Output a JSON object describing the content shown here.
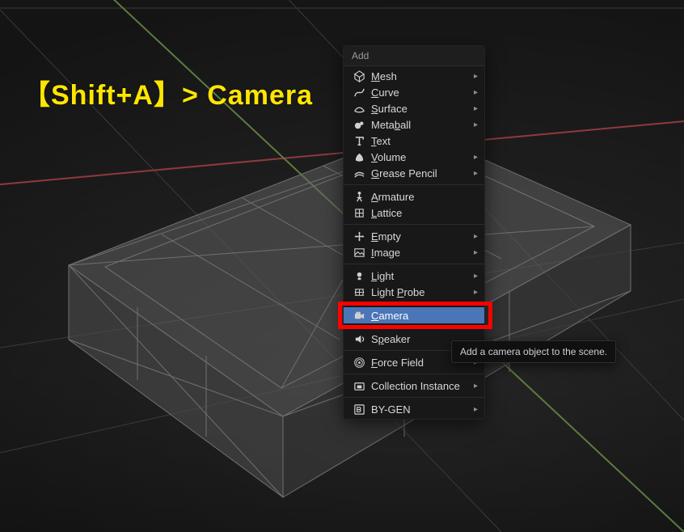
{
  "annotation": "【Shift+A】> Camera",
  "menu": {
    "title": "Add",
    "groups": [
      [
        {
          "icon": "mesh",
          "label": "Mesh",
          "underline": 0,
          "submenu": true
        },
        {
          "icon": "curve",
          "label": "Curve",
          "underline": 0,
          "submenu": true
        },
        {
          "icon": "surface",
          "label": "Surface",
          "underline": 0,
          "submenu": true
        },
        {
          "icon": "metaball",
          "label": "Metaball",
          "underline": 4,
          "submenu": true
        },
        {
          "icon": "text",
          "label": "Text",
          "underline": 0,
          "submenu": false
        },
        {
          "icon": "volume",
          "label": "Volume",
          "underline": 0,
          "submenu": true
        },
        {
          "icon": "gpencil",
          "label": "Grease Pencil",
          "underline": 0,
          "submenu": true
        }
      ],
      [
        {
          "icon": "armature",
          "label": "Armature",
          "underline": 0,
          "submenu": false
        },
        {
          "icon": "lattice",
          "label": "Lattice",
          "underline": 0,
          "submenu": false
        }
      ],
      [
        {
          "icon": "empty",
          "label": "Empty",
          "underline": 0,
          "submenu": true
        },
        {
          "icon": "image",
          "label": "Image",
          "underline": 0,
          "submenu": true
        }
      ],
      [
        {
          "icon": "light",
          "label": "Light",
          "underline": 0,
          "submenu": true
        },
        {
          "icon": "lightprobe",
          "label": "Light Probe",
          "underline": 6,
          "submenu": true
        }
      ],
      [
        {
          "icon": "camera",
          "label": "Camera",
          "underline": 0,
          "submenu": false,
          "highlight": true
        }
      ],
      [
        {
          "icon": "speaker",
          "label": "Speaker",
          "underline": 1,
          "submenu": false
        }
      ],
      [
        {
          "icon": "force",
          "label": "Force Field",
          "underline": 0,
          "submenu": true
        }
      ],
      [
        {
          "icon": "collection",
          "label": "Collection Instance",
          "underline": -1,
          "submenu": true
        }
      ],
      [
        {
          "icon": "bygen",
          "label": "BY-GEN",
          "underline": -1,
          "submenu": true
        }
      ]
    ]
  },
  "tooltip": "Add a camera object to the scene.",
  "axes": {
    "x_color": "#9c3b3b",
    "y_color": "#5e8a3a",
    "grid_color": "#3a3a3a"
  }
}
